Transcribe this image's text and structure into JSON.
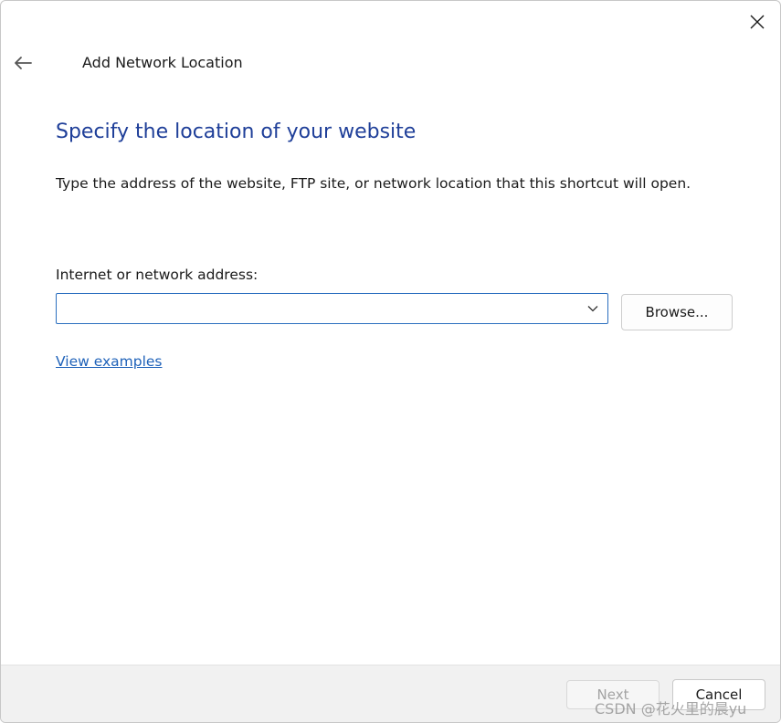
{
  "window": {
    "title": "Add Network Location",
    "close_icon": "close-icon",
    "back_icon": "back-arrow-icon"
  },
  "main": {
    "heading": "Specify the location of your website",
    "instruction": "Type the address of the website, FTP site, or network location that this shortcut will open.",
    "address_label": "Internet or network address:",
    "address_value": "",
    "address_placeholder": "",
    "dropdown_icon": "chevron-down-icon",
    "browse_label": "Browse...",
    "examples_link": "View examples"
  },
  "footer": {
    "next_label": "Next",
    "next_enabled": false,
    "cancel_label": "Cancel"
  },
  "watermark": "CSDN @花火里的晨yu",
  "colors": {
    "heading": "#1f3f99",
    "link": "#1f62b9",
    "input_border": "#2b6fbf",
    "footer_bg": "#f1f1f1"
  }
}
